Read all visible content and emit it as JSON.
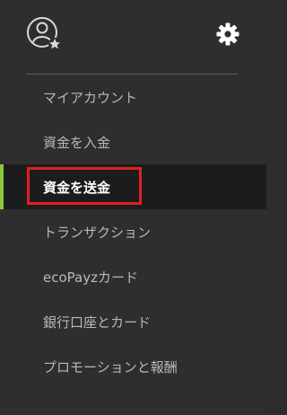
{
  "header": {
    "avatar_icon": "user-avatar-icon",
    "settings_icon": "gear-icon"
  },
  "menu": {
    "items": [
      {
        "label": "マイアカウント",
        "active": false
      },
      {
        "label": "資金を入金",
        "active": false
      },
      {
        "label": "資金を送金",
        "active": true
      },
      {
        "label": "トランザクション",
        "active": false
      },
      {
        "label": "ecoPayzカード",
        "active": false
      },
      {
        "label": "銀行口座とカード",
        "active": false
      },
      {
        "label": "プロモーションと報酬",
        "active": false
      }
    ]
  },
  "colors": {
    "background": "#2e2e2e",
    "active_background": "#1c1c1c",
    "active_accent": "#8dc63f",
    "highlight_border": "#e02020",
    "text": "#b8b8b8",
    "active_text": "#ffffff"
  }
}
